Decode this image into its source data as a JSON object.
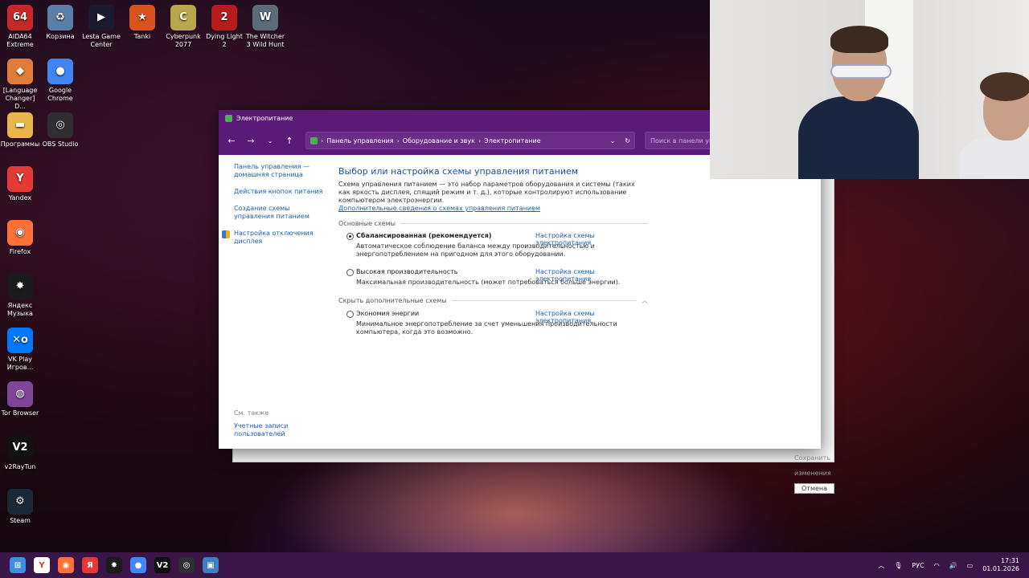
{
  "desktop_icons": [
    {
      "label": "AIDA64 Extreme",
      "glyph": "64",
      "color": "#c62828"
    },
    {
      "label": "Корзина",
      "glyph": "♻",
      "color": "#5a7fa8"
    },
    {
      "label": "Lesta Game Center",
      "glyph": "▶",
      "color": "#1b1b2f"
    },
    {
      "label": "Tanki",
      "glyph": "★",
      "color": "#d9531e"
    },
    {
      "label": "Cyberpunk 2077",
      "glyph": "C",
      "color": "#b9a84b"
    },
    {
      "label": "Dying Light 2",
      "glyph": "2",
      "color": "#b71c1c"
    },
    {
      "label": "The Witcher 3 Wild Hunt",
      "glyph": "W",
      "color": "#5b6b78"
    },
    {
      "label": "[Language Changer] D...",
      "glyph": "◆",
      "color": "#e07b39"
    },
    {
      "label": "Google Chrome",
      "glyph": "●",
      "color": "#4285f4"
    },
    {
      "label": "Программы",
      "glyph": "▬",
      "color": "#e9b64a"
    },
    {
      "label": "OBS Studio",
      "glyph": "◎",
      "color": "#302e31"
    },
    {
      "label": "Yandex",
      "glyph": "Y",
      "color": "#e53935"
    },
    {
      "label": "Firefox",
      "glyph": "◉",
      "color": "#ff7139"
    },
    {
      "label": "Яндекс Музыка",
      "glyph": "✸",
      "color": "#1b1b1b"
    },
    {
      "label": "VK Play Игров...",
      "glyph": "✕o",
      "color": "#0077ff"
    },
    {
      "label": "Tor Browser",
      "glyph": "◍",
      "color": "#7d4698"
    },
    {
      "label": "v2RayTun",
      "glyph": "V2",
      "color": "#111111"
    },
    {
      "label": "Steam",
      "glyph": "⚙",
      "color": "#1b2838"
    }
  ],
  "window": {
    "title": "Электропитание",
    "breadcrumbs": [
      "Панель управления",
      "Оборудование и звук",
      "Электропитание"
    ],
    "search_placeholder": "Поиск в панели управ...",
    "sidebar": {
      "home": "Панель управления — домашняя страница",
      "links": [
        "Действия кнопок питания",
        "Создание схемы управления питанием",
        "Настройка отключения дисплея"
      ],
      "see_also_heading": "См. также",
      "see_also_link": "Учетные записи пользователей"
    },
    "main": {
      "heading": "Выбор или настройка схемы управления питанием",
      "description": "Схема управления питанием — это набор параметров оборудования и системы (таких как яркость дисплея, спящий режим и т. д.), которые контролируют использование компьютером электроэнергии.",
      "more_link": "Дополнительные сведения о схемах управления питанием",
      "section_basic": "Основные схемы",
      "section_hidden": "Скрыть дополнительные схемы",
      "settings_link": "Настройка схемы электропитания",
      "plans": [
        {
          "name": "Сбалансированная (рекомендуется)",
          "desc": "Автоматическое соблюдение баланса между производительностью и энергопотреблением на пригодном для этого оборудовании.",
          "selected": true
        },
        {
          "name": "Высокая производительность",
          "desc": "Максимальная производительность (может потребоваться больше энергии).",
          "selected": false
        },
        {
          "name": "Экономия энергии",
          "desc": "Минимальное энергопотребление за счет уменьшения производительности компьютера, когда это возможно.",
          "selected": false
        }
      ]
    }
  },
  "back_dialog": {
    "save_label": "Сохранить изменения",
    "cancel_label": "Отмена"
  },
  "taskbar": {
    "apps": [
      {
        "name": "start-button",
        "glyph": "⊞",
        "color": "#3b8fe0"
      },
      {
        "name": "yandex-browser",
        "glyph": "Y",
        "color": "#ffffff"
      },
      {
        "name": "firefox",
        "glyph": "◉",
        "color": "#ff7139"
      },
      {
        "name": "yandex",
        "glyph": "Я",
        "color": "#e53935"
      },
      {
        "name": "yandex-music",
        "glyph": "✸",
        "color": "#1b1b1b"
      },
      {
        "name": "chrome",
        "glyph": "●",
        "color": "#4285f4"
      },
      {
        "name": "v2raytun",
        "glyph": "V2",
        "color": "#111111"
      },
      {
        "name": "obs",
        "glyph": "◎",
        "color": "#302e31"
      },
      {
        "name": "control-panel",
        "glyph": "▣",
        "color": "#3f7fbf"
      }
    ],
    "language": "РУС",
    "time": "17:31",
    "date": "01.01.2026"
  }
}
